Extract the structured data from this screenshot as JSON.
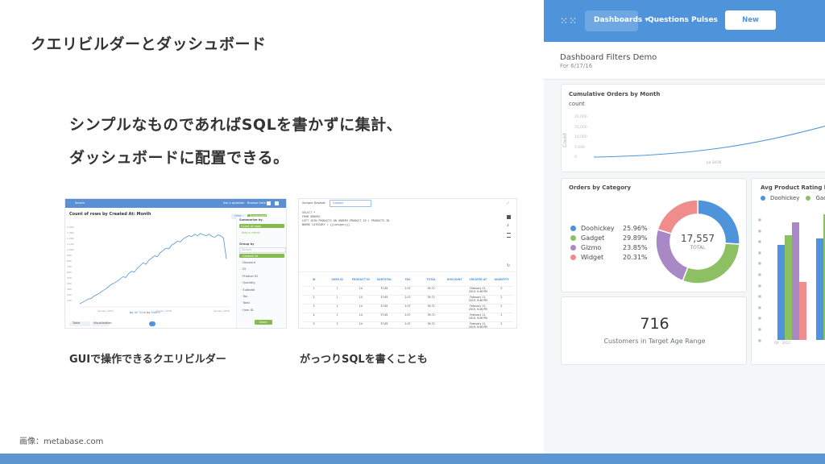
{
  "slide": {
    "title": "クエリビルダーとダッシュボード",
    "headline_line1": "シンプルなものであればSQLを書かずに集計、",
    "headline_line2": "ダッシュボードに配置できる。",
    "caption_left": "GUIで操作できるクエリビルダー",
    "caption_right": "がっつりSQLを書くことも",
    "credit": "画像：metabase.com"
  },
  "colors": {
    "accent_blue": "#4f94db",
    "bar_blue": "#5b95d2",
    "doohickey": "#4f94db",
    "gadget": "#8cc063",
    "gizmo": "#a989c5",
    "widget": "#ef8c8c"
  },
  "thumb_query_builder": {
    "nav_label": "Search",
    "nav_ask": "Ask a question",
    "nav_browse": "Browse Data",
    "title": "Count of rows by Created At: Month",
    "filter_label": "Filter",
    "summarize_label": "Summarize",
    "side_summarize": "Summarize by",
    "side_count": "Count of rows",
    "side_add_metric": "Add a metric",
    "side_group": "Group by",
    "side_search": "Search",
    "side_created": "Created At",
    "side_fields": [
      "Discount",
      "ID",
      "Product ID",
      "Quantity",
      "Subtotal",
      "Tax",
      "Total",
      "User ID"
    ],
    "done": "Done",
    "footer_left": "Table",
    "footer_right": "Visualization",
    "by": "by",
    "all_time": "All Time",
    "month": "Month",
    "x_ticks": [
      "January 2017",
      "January 2018",
      "January 2019"
    ],
    "y_ticks": [
      "1,400",
      "1,300",
      "1,200",
      "1,100",
      "1,000",
      "900",
      "800",
      "700",
      "600",
      "500",
      "400",
      "300",
      "200",
      "100"
    ],
    "series": [
      0.02,
      0.04,
      0.06,
      0.08,
      0.09,
      0.12,
      0.14,
      0.16,
      0.19,
      0.21,
      0.24,
      0.27,
      0.29,
      0.31,
      0.34,
      0.37,
      0.36,
      0.41,
      0.44,
      0.43,
      0.48,
      0.51,
      0.55,
      0.53,
      0.58,
      0.61,
      0.64,
      0.63,
      0.68,
      0.71,
      0.74,
      0.73,
      0.78,
      0.8,
      0.83,
      0.82,
      0.86,
      0.88,
      0.9,
      0.89,
      0.92,
      0.9,
      0.93,
      0.91,
      0.9,
      0.92,
      0.89,
      0.88,
      0.91,
      0.9,
      0.87,
      0.6
    ]
  },
  "thumb_sql": {
    "db_label": "Sample Dataset",
    "table_label": "Gadget",
    "sql_lines": [
      "SELECT *",
      "FROM ORDERS",
      "LEFT JOIN PRODUCTS ON ORDERS.PRODUCT_ID = PRODUCTS.ID",
      "WHERE CATEGORY = {{category}}"
    ],
    "columns": [
      "ID",
      "USER ID",
      "PRODUCT ID",
      "SUBTOTAL",
      "TAX",
      "TOTAL",
      "DISCOUNT",
      "CREATED AT",
      "QUANTITY"
    ],
    "rows": [
      [
        "1",
        "1",
        "14",
        "37.65",
        "2.07",
        "39.72",
        "",
        "February 11, 2019, 9:46 PM",
        "2"
      ],
      [
        "2",
        "1",
        "14",
        "37.65",
        "2.07",
        "39.72",
        "",
        "February 11, 2019, 9:46 PM",
        "2"
      ],
      [
        "3",
        "1",
        "14",
        "37.65",
        "2.07",
        "39.72",
        "",
        "February 11, 2019, 9:46 PM",
        "2"
      ],
      [
        "4",
        "1",
        "14",
        "37.65",
        "2.07",
        "39.72",
        "",
        "February 11, 2019, 9:46 PM",
        "2"
      ],
      [
        "5",
        "1",
        "14",
        "37.65",
        "2.07",
        "39.72",
        "",
        "February 11, 2019, 9:46 PM",
        "2"
      ],
      [
        "6",
        "1",
        "14",
        "37.65",
        "2.07",
        "39.72",
        "",
        "February 11, 2019, 9:46 PM",
        "2"
      ],
      [
        "7",
        "1",
        "14",
        "37.65",
        "2.07",
        "39.72",
        "",
        "February 11, 2019, 9:46 PM",
        "2"
      ]
    ]
  },
  "dashboard": {
    "nav": {
      "dashboards": "Dashboards",
      "questions": "Questions",
      "pulses": "Pulses",
      "new_question": "New Question"
    },
    "title": "Dashboard Filters Demo",
    "subtitle": "For 6/17/16",
    "cumulative": {
      "title": "Cumulative Orders by Month",
      "subtitle": "count",
      "axis_label": "Count",
      "y_ticks": [
        "20,000",
        "15,000",
        "10,000",
        "5,000",
        "0"
      ],
      "x_tick": "Jul 2016"
    },
    "orders_by_category": {
      "title": "Orders by Category",
      "total_value": "17,557",
      "total_label": "TOTAL",
      "legend": [
        {
          "name": "Doohickey",
          "value": "25.96%"
        },
        {
          "name": "Gadget",
          "value": "29.89%"
        },
        {
          "name": "Gizmo",
          "value": "23.85%"
        },
        {
          "name": "Widget",
          "value": "20.31%"
        }
      ]
    },
    "avg_rating": {
      "title": "Avg Product Rating by ca",
      "legend": [
        "Doohickey",
        "Gadg"
      ],
      "x_tick": "Q4 - 2015"
    },
    "kpi": {
      "value": "716",
      "label": "Customers in Target Age Range"
    }
  }
}
